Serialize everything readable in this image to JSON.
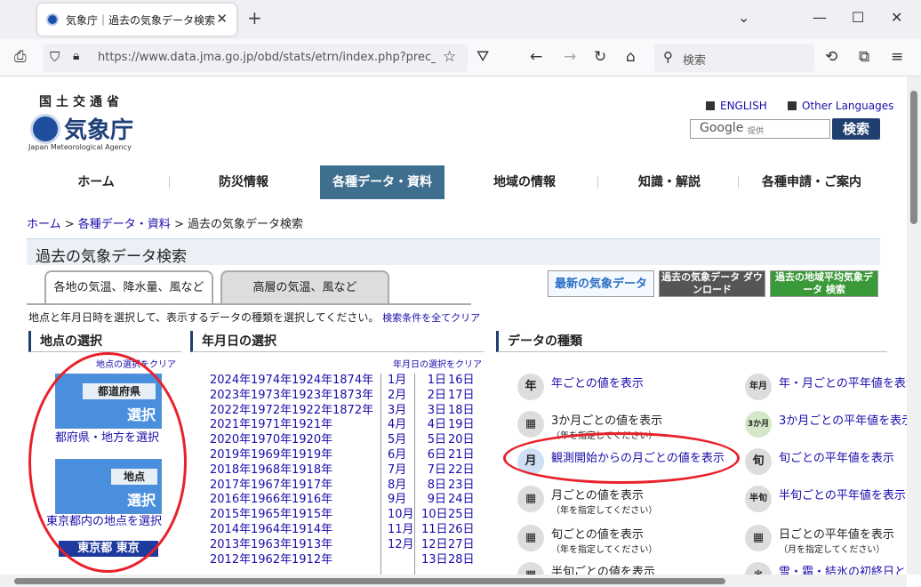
{
  "browser": {
    "tab_title": "気象庁｜過去の気象データ検索",
    "url": "https://www.data.jma.go.jp/obd/stats/etrn/index.php?prec_no=",
    "search_placeholder": "検索"
  },
  "header": {
    "logo_line1": "国土交通省",
    "logo_name": "気象庁",
    "logo_en": "Japan Meteorological Agency",
    "english": "ENGLISH",
    "other_languages": "Other Languages",
    "google": "Google",
    "google_sub": "提供",
    "search_btn": "検索"
  },
  "menu": [
    "ホーム",
    "防災情報",
    "各種データ・資料",
    "地域の情報",
    "知識・解説",
    "各種申請・ご案内"
  ],
  "breadcrumb": {
    "home": "ホーム",
    "data": "各種データ・資料",
    "current": "過去の気象データ検索"
  },
  "page_title": "過去の気象データ検索",
  "tabs": {
    "t1": "各地の気温、降水量、風など",
    "t2": "高層の気温、風など"
  },
  "banners": {
    "b1": "最新の気象データ",
    "b2": "過去の気象データ ダウンロード",
    "b3": "過去の地域平均気象データ 検索"
  },
  "instruction": "地点と年月日時を選択して、表示するデータの種類を選択してください。",
  "clear_all": "検索条件を全てクリア",
  "sections": {
    "point": "地点の選択",
    "date": "年月日の選択",
    "type": "データの種類"
  },
  "point_clear": "地点の選択をクリア",
  "date_clear": "年月日の選択をクリア",
  "point": {
    "pref_label": "都道府県",
    "pref_sel": "選択",
    "pref_link": "都府県・地方を選択",
    "pt_label": "地点",
    "pt_sel": "選択",
    "pt_link": "東京都内の地点を選択",
    "selected": "東京都 東京"
  },
  "years": [
    "2024年",
    "2023年",
    "2022年",
    "2021年",
    "2020年",
    "2019年",
    "2018年",
    "2017年",
    "2016年",
    "2015年",
    "2014年",
    "2013年",
    "2012年"
  ],
  "years2": [
    "1974年",
    "1973年",
    "1972年",
    "1971年",
    "1970年",
    "1969年",
    "1968年",
    "1967年",
    "1966年",
    "1965年",
    "1964年",
    "1963年",
    "1962年"
  ],
  "years3": [
    "1924年",
    "1923年",
    "1922年",
    "1921年",
    "1920年",
    "1919年",
    "1918年",
    "1917年",
    "1916年",
    "1915年",
    "1914年",
    "1913年",
    "1912年"
  ],
  "years4": [
    "1874年",
    "1873年",
    "1872年"
  ],
  "months": [
    "1月",
    "2月",
    "3月",
    "4月",
    "5月",
    "6月",
    "7月",
    "8月",
    "9月",
    "10月",
    "11月",
    "12月"
  ],
  "days1": [
    "1日",
    "2日",
    "3日",
    "4日",
    "5日",
    "6日",
    "7日",
    "8日",
    "9日",
    "10日",
    "11日",
    "12日",
    "13日"
  ],
  "days2": [
    "16日",
    "17日",
    "18日",
    "19日",
    "20日",
    "21日",
    "22日",
    "23日",
    "24日",
    "25日",
    "26日",
    "27日",
    "28日"
  ],
  "types": {
    "yearly": "年ごとの値を表示",
    "yearly_icon": "年",
    "three_month": "3か月ごとの値を表示",
    "three_month_sub": "（年を指定してください）",
    "monthly_all": "観測開始からの月ごとの値を表示",
    "monthly_all_icon": "月",
    "monthly": "月ごとの値を表示",
    "monthly_sub": "（年を指定してください）",
    "dekad": "旬ごとの値を表示",
    "dekad_sub": "（年を指定してください）",
    "half_dekad": "半旬ごとの値を表示",
    "n_year_month": "年・月ごとの平年値を表示",
    "n_year_month_icon": "年月",
    "n_three_month": "3か月ごとの平年値を表示",
    "n_three_month_icon": "3か月",
    "n_dekad": "旬ごとの平年値を表示",
    "n_dekad_icon": "旬",
    "n_half_dekad": "半旬ごとの平年値を表示",
    "n_half_dekad_icon": "半旬",
    "n_daily": "日ごとの平年値を表示",
    "n_daily_sub": "（月を指定してください）",
    "snow": "雪・霜・結氷の初終日と"
  }
}
